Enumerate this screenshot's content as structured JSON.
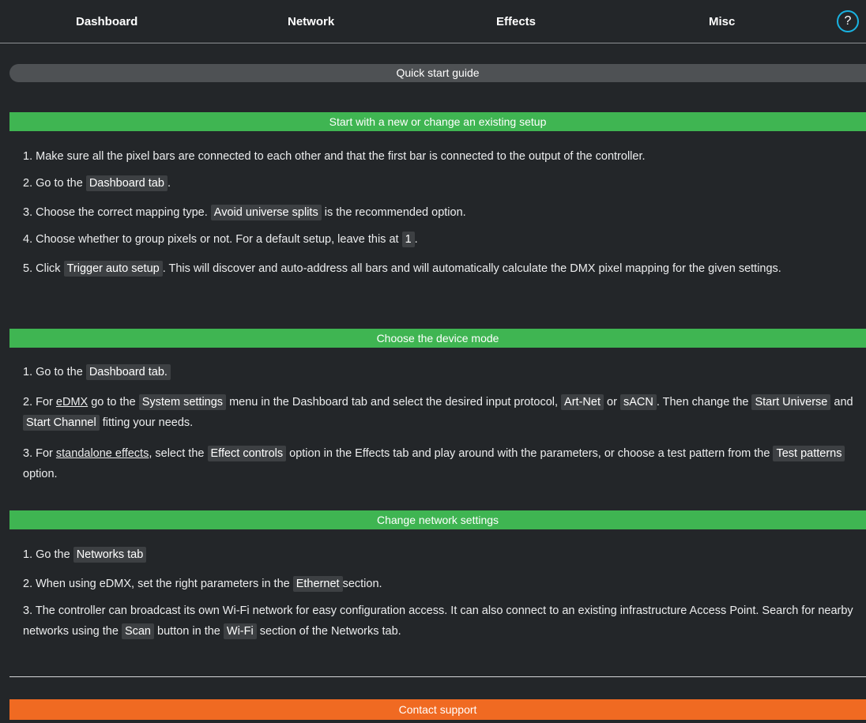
{
  "nav": {
    "tabs": [
      "Dashboard",
      "Network",
      "Effects",
      "Misc"
    ],
    "help_label": "?"
  },
  "quick_start_label": "Quick start guide",
  "sections": [
    {
      "title": "Start with a new or change an existing setup",
      "steps": [
        {
          "t1": "1. Make sure all the pixel bars are connected to each other and that the first bar is connected to the output of the controller."
        },
        {
          "t1": "2. Go to the",
          "c1": "Dashboard tab",
          "t2": "."
        },
        {
          "t1": "3. Choose the correct mapping type.",
          "c1": "Avoid universe splits",
          "t2": "is the recommended option."
        },
        {
          "t1": "4. Choose whether to group pixels or not. For a default setup, leave this at",
          "c1": "1",
          "t2": "."
        },
        {
          "t1": "5. Click",
          "c1": "Trigger auto setup",
          "t2": ". This will discover and auto-address all bars and will automatically calculate the DMX pixel mapping for the given settings."
        }
      ]
    },
    {
      "title": "Choose the device mode",
      "steps": [
        {
          "t1": "1. Go to the",
          "c1": "Dashboard tab."
        },
        {
          "t1": "2. For",
          "u1": "eDMX",
          "t2": "go to the",
          "c1": "System settings",
          "t3": "menu in the Dashboard tab and select the desired input protocol,",
          "c2": "Art-Net",
          "t4": "or",
          "c3": "sACN",
          "t5": ". Then change the",
          "c4": "Start Universe",
          "t6": "and",
          "c5": "Start Channel",
          "t7": "fitting your needs."
        },
        {
          "t1": "3. For",
          "u1": "standalone effects",
          "t2": ", select the",
          "c1": "Effect controls",
          "t3": "option in the Effects tab and play around with the parameters, or choose a test pattern from the",
          "c2": "Test patterns",
          "t4": "option."
        }
      ]
    },
    {
      "title": "Change network settings",
      "steps": [
        {
          "t1": "1. Go the",
          "c1": "Networks tab"
        },
        {
          "t1": "2. When using eDMX, set the right parameters in the",
          "c1": "Ethernet",
          "t2": "section."
        },
        {
          "t1": "3. The controller can broadcast its own Wi-Fi network for easy configuration access. It can also connect to an existing infrastructure Access Point. Search for nearby networks using the",
          "c1": "Scan",
          "t2": "button in the",
          "c2": "Wi-Fi",
          "t3": "section of the Networks tab."
        }
      ]
    }
  ],
  "contact_label": "Contact support",
  "colors": {
    "background": "#232629",
    "section_header": "#3fb552",
    "contact_button": "#f06a22",
    "help_ring": "#19b3e2",
    "chip": "#3d4043"
  }
}
